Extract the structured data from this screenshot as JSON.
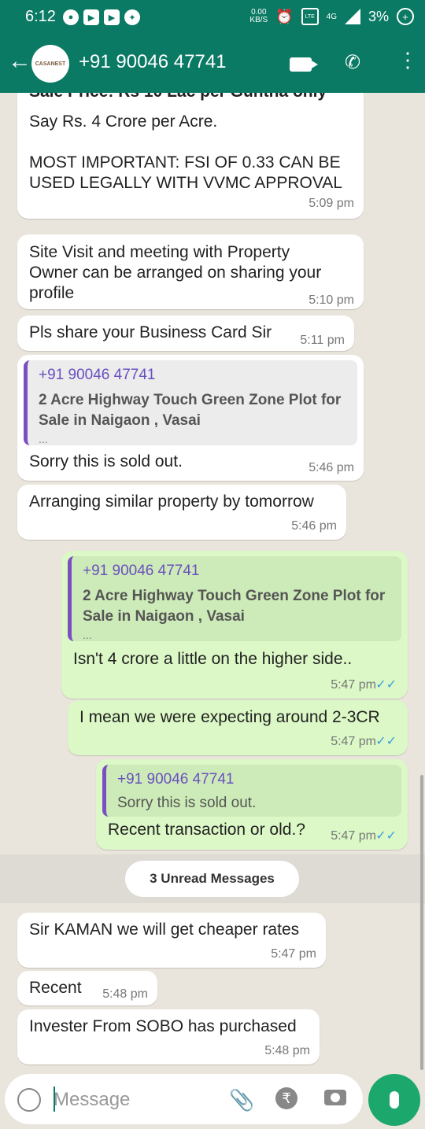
{
  "status_bar": {
    "time": "6:12",
    "net_speed": "0.00\nKB/S",
    "battery": "3%",
    "network": "4G"
  },
  "header": {
    "contact": "+91 90046 47741",
    "avatar_text": "CASANEST"
  },
  "messages": [
    {
      "dir": "in",
      "text": "Sale Price: Rs 10 Lac per Guntha only",
      "time": ""
    },
    {
      "dir": "in",
      "text": "Say Rs. 4 Crore per Acre.\n\nMOST IMPORTANT: FSI OF 0.33 CAN BE\nUSED LEGALLY WITH VVMC APPROVAL",
      "time": "5:09 pm"
    },
    {
      "dir": "in",
      "text": "Site Visit and meeting with Property\nOwner can be arranged on sharing your\nprofile",
      "time": "5:10 pm"
    },
    {
      "dir": "in",
      "text": "Pls share your Business Card Sir",
      "time": "5:11 pm"
    },
    {
      "dir": "in",
      "quote_author": "+91 90046 47741",
      "quote_text": "2 Acre  Highway Touch   Green Zone Plot for\nSale in Naigaon , Vasai",
      "quote_more": "...",
      "text": "Sorry this is sold out.",
      "time": "5:46 pm"
    },
    {
      "dir": "in",
      "text": "Arranging similar property by tomorrow",
      "time": "5:46 pm"
    },
    {
      "dir": "out",
      "quote_author": "+91 90046 47741",
      "quote_text": "2 Acre  Highway Touch   Green Zone Plot for\nSale in Naigaon , Vasai",
      "quote_more": "...",
      "text": "Isn't 4 crore a little on the higher side..",
      "time": "5:47 pm"
    },
    {
      "dir": "out",
      "text": "I mean we were expecting around 2-3CR",
      "time": "5:47 pm"
    },
    {
      "dir": "out",
      "quote_author": "+91 90046 47741",
      "quote_text": "Sorry this is sold out.",
      "text": "Recent transaction or old.?",
      "time": "5:47 pm"
    },
    {
      "dir": "in",
      "text": "Sir KAMAN we will get cheaper rates",
      "time": "5:47 pm"
    },
    {
      "dir": "in",
      "text": "Recent",
      "time": "5:48 pm"
    },
    {
      "dir": "in",
      "text": "Invester From SOBO has purchased",
      "time": "5:48 pm"
    }
  ],
  "unread_label": "3 Unread Messages",
  "input": {
    "placeholder": "Message"
  },
  "icons": {
    "back": "arrow-left-icon",
    "video": "video-call-icon",
    "call": "phone-icon",
    "more": "more-vert-icon",
    "emoji": "emoji-icon",
    "attach": "paperclip-icon",
    "rupee": "rupee-icon",
    "camera": "camera-icon",
    "mic": "mic-icon"
  },
  "colors": {
    "header": "#0a7a64",
    "incoming": "#ffffff",
    "outgoing": "#dcf8c6",
    "quote_accent": "#7a4fc0",
    "read_ticks": "#3aa0e0",
    "mic": "#1ca86c"
  }
}
